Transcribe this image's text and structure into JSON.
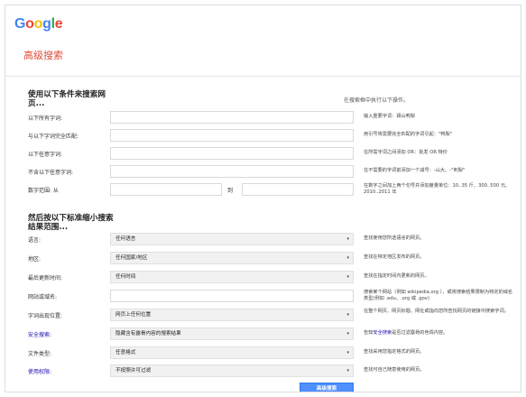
{
  "logo": {
    "letters": [
      "G",
      "o",
      "o",
      "g",
      "l",
      "e"
    ]
  },
  "colors": {
    "g_blue": "#4285f4",
    "g_red": "#ea4335",
    "g_yellow": "#fbbc05",
    "g_green": "#34a853",
    "title_red": "#dd4b39",
    "link_blue": "#1a0dab",
    "button_blue": "#4d90fe"
  },
  "page_title": "高级搜索",
  "section1": {
    "title": "使用以下条件来搜索网页...",
    "side_heading": "在搜索框中执行以下操作。",
    "rows": [
      {
        "label": "以下所有字词:",
        "hint": "输入重要字词：砀山鸭梨"
      },
      {
        "label": "与以下字词完全匹配:",
        "hint": "用引号将需要完全匹配的字词引起：\"鸭梨\""
      },
      {
        "label": "以下任意字词:",
        "hint": "在所需字词之间添加 OR：批发 OR 特价"
      },
      {
        "label": "不含以下任意字词:",
        "hint": "在不需要的字词前添加一个减号：-山大、-\"刺梨\""
      },
      {
        "label": "数字范围: 从",
        "to": "到",
        "hint": "在数字之间加上两个句号并添加度量单位：10..35 斤、300..500 元、2010..2011 年"
      }
    ]
  },
  "section2": {
    "title": "然后按以下标准缩小搜索结果范围...",
    "rows": [
      {
        "label": "语言:",
        "value": "任何语言",
        "hint": "查找使用您所选语言的网页。"
      },
      {
        "label": "地区:",
        "value": "任何国家/地区",
        "hint": "查找在特定地区发布的网页。"
      },
      {
        "label": "最后更新时间:",
        "value": "任何时间",
        "hint": "查找在指定时间内更新的网页。"
      },
      {
        "label": "网站或域名:",
        "value": "",
        "hint": "搜索某个网站（例如 wikipedia.org ），或将搜索结果限制为特定的域名类型(例如 .edu、.org 或 .gov)"
      },
      {
        "label": "字词出现位置:",
        "value": "网页上任何位置",
        "hint": "在整个网页、网页标题、网址或指向您所查找网页的链接中搜索字词。"
      },
      {
        "label": "安全搜索:",
        "value": "隐藏含有露骨内容的搜索结果",
        "hint_pre": "告知",
        "hint_link": "安全搜索",
        "hint_post": "是否过滤露骨的色情内容。"
      },
      {
        "label": "文件类型:",
        "value": "任意格式",
        "hint": "查找采用您指定格式的网页。"
      },
      {
        "label": "使用权限:",
        "value": "不按照许可过滤",
        "hint": "查找可自己随意使用的网页。"
      }
    ]
  },
  "submit_label": "高级搜索",
  "caret": "▾"
}
